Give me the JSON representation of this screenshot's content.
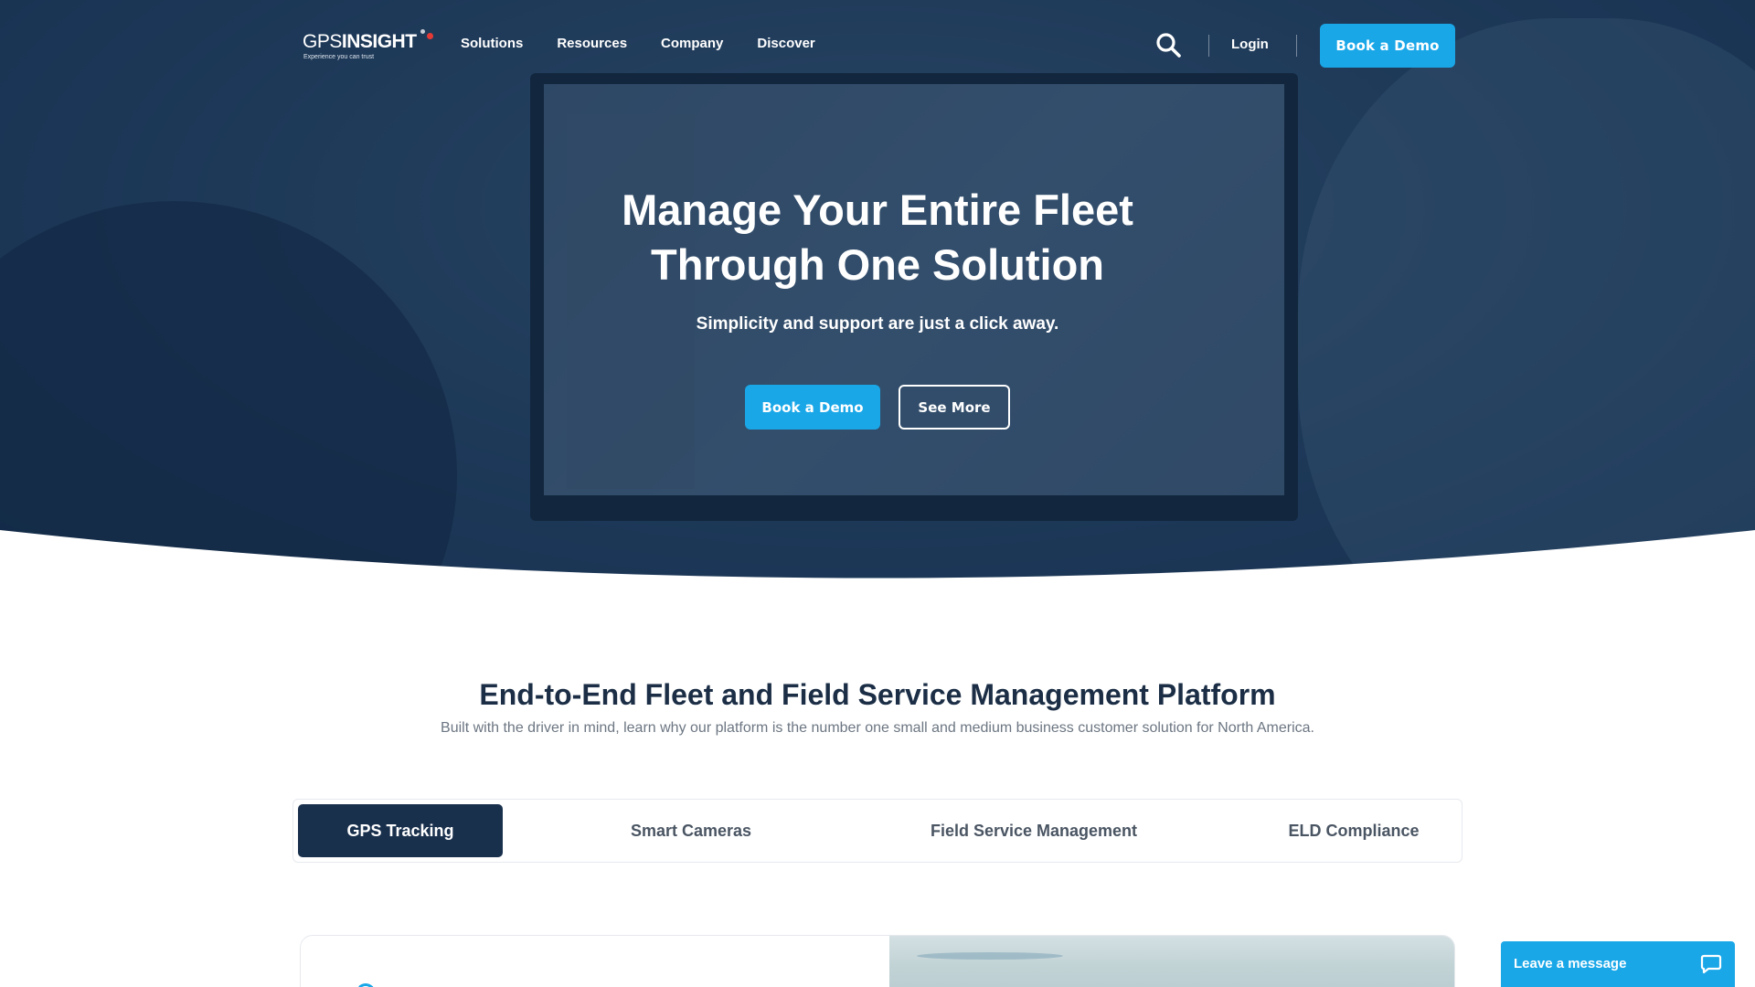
{
  "brand": {
    "logo_light": "GPS",
    "logo_bold": "INSIGHT",
    "tagline": "Experience you can trust"
  },
  "nav": {
    "items": [
      {
        "label": "Solutions"
      },
      {
        "label": "Resources"
      },
      {
        "label": "Company"
      },
      {
        "label": "Discover"
      }
    ],
    "search_icon": "search-icon",
    "login_label": "Login",
    "demo_label": "Book a Demo"
  },
  "hero": {
    "title_line1": "Manage Your Entire Fleet",
    "title_line2": "Through One Solution",
    "subtitle": "Simplicity and support are just a click away.",
    "primary_cta": "Book a Demo",
    "secondary_cta": "See More"
  },
  "platform": {
    "title": "End-to-End Fleet and Field Service Management Platform",
    "subtitle": "Built with the driver in mind, learn why our platform is the number one small and medium business customer solution for North America.",
    "tabs": [
      {
        "label": "GPS Tracking",
        "active": true
      },
      {
        "label": "Smart Cameras",
        "active": false
      },
      {
        "label": "Field Service Management",
        "active": false
      },
      {
        "label": "ELD Compliance",
        "active": false
      }
    ]
  },
  "chat": {
    "label": "Leave a message",
    "icon": "chat-bubble-icon"
  },
  "colors": {
    "accent": "#1aa7e8",
    "navy": "#19304d",
    "heading": "#1b2e45",
    "logo_dot": "#e53935"
  }
}
